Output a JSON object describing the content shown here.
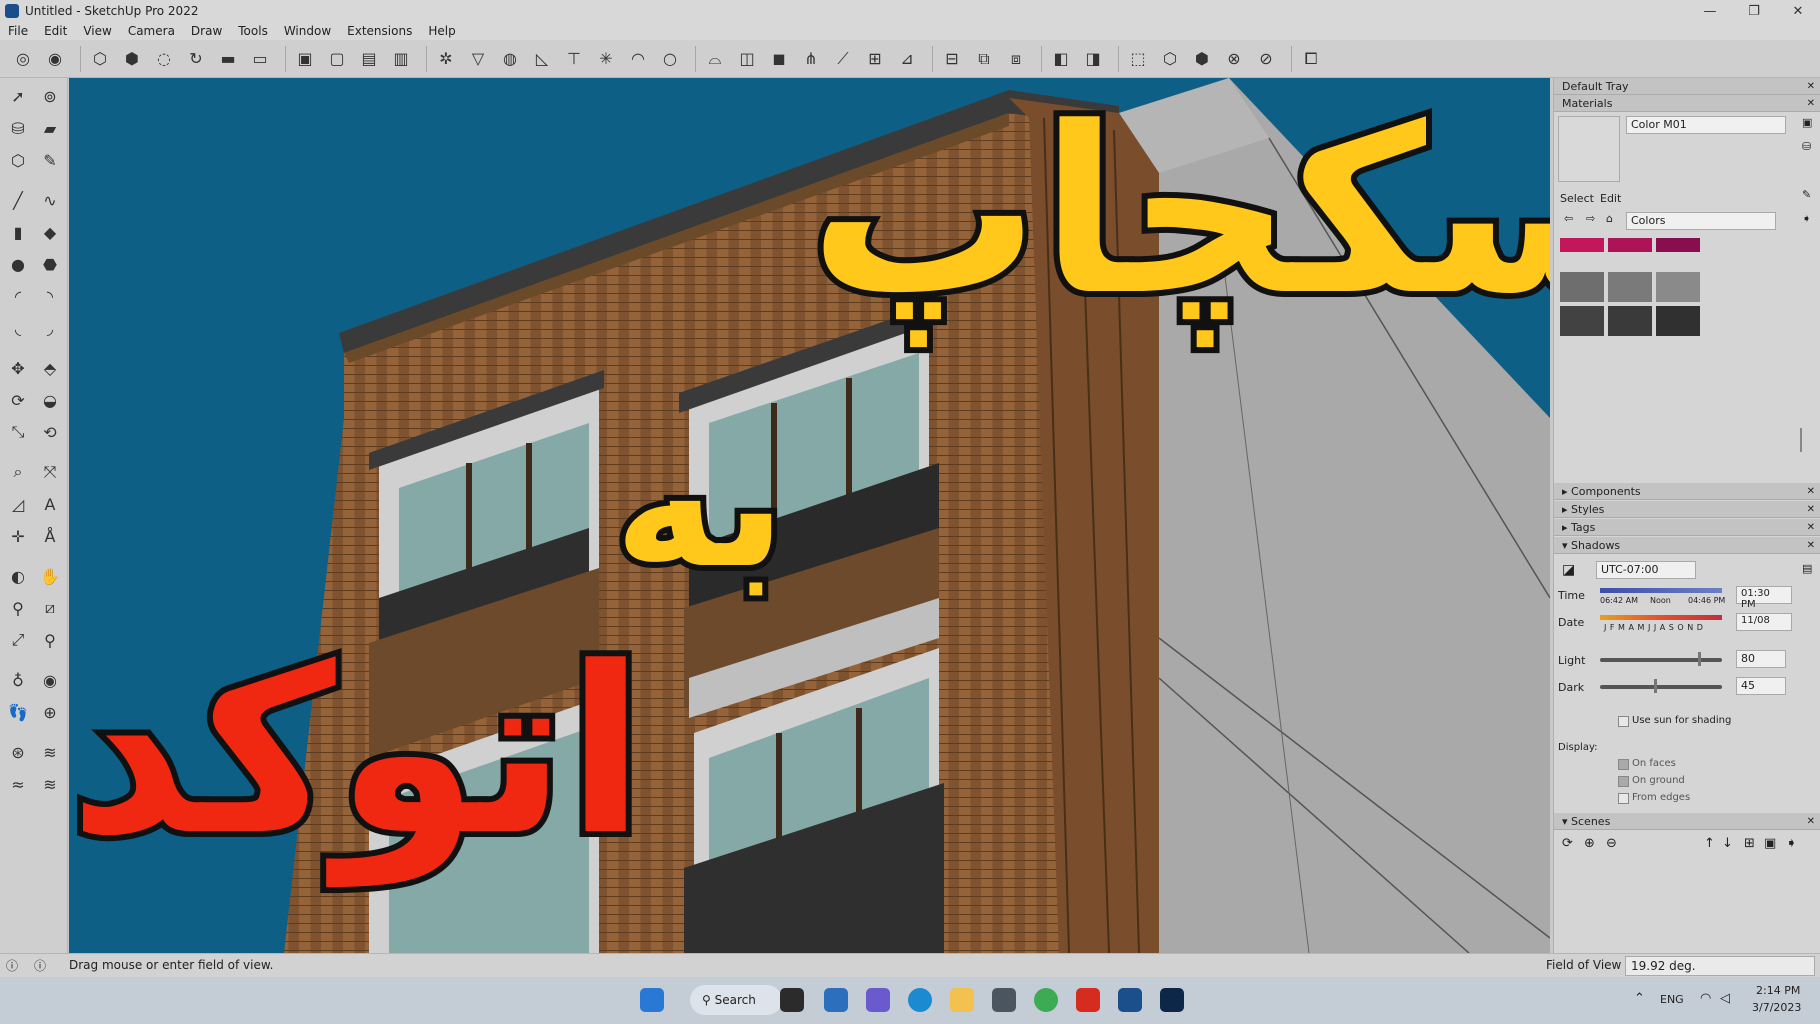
{
  "window": {
    "title": "Untitled - SketchUp Pro 2022",
    "controls": [
      "—",
      "❐",
      "✕"
    ]
  },
  "menu": [
    "File",
    "Edit",
    "View",
    "Camera",
    "Draw",
    "Tools",
    "Window",
    "Extensions",
    "Help"
  ],
  "overlay_text": {
    "line1": "اسکچاپ",
    "line2": "به",
    "line3": "اتوکد"
  },
  "tray": {
    "default_tray_title": "Default Tray",
    "materials": {
      "title": "Materials",
      "material_name": "Color M01",
      "tabs": [
        "Select",
        "Edit"
      ],
      "library": "Colors",
      "swatch_colors": [
        "#c2185b",
        "#ad1457",
        "#880e4f",
        "#6e6e6e",
        "#7a7a7a",
        "#8a8a8a",
        "#424242",
        "#3a3a3a",
        "#303030"
      ]
    },
    "sections": {
      "components": "Components",
      "styles": "Styles",
      "tags": "Tags",
      "shadows": "Shadows",
      "scenes": "Scenes"
    },
    "shadows": {
      "timezone": "UTC-07:00",
      "time_label": "Time",
      "time_sunrise": "06:42 AM",
      "time_noon": "Noon",
      "time_sunset": "04:46 PM",
      "time_value": "01:30 PM",
      "date_label": "Date",
      "months": "J F M A M J J A S O N D",
      "date_value": "11/08",
      "light_label": "Light",
      "light_value": "80",
      "dark_label": "Dark",
      "dark_value": "45",
      "use_sun": "Use sun for shading",
      "display_label": "Display:",
      "on_faces": "On faces",
      "on_ground": "On ground",
      "from_edges": "From edges"
    }
  },
  "status": {
    "hint": "Drag mouse or enter field of view.",
    "vcb_label": "Field of View",
    "vcb_value": "19.92 deg."
  },
  "taskbar": {
    "search": "Search",
    "language": "ENG",
    "time": "2:14 PM",
    "date": "3/7/2023"
  },
  "colors": {
    "sky": "#0e5f86",
    "brick": "#8a5a32",
    "overlay_yellow": "#ffc81a",
    "overlay_red": "#f02812"
  }
}
